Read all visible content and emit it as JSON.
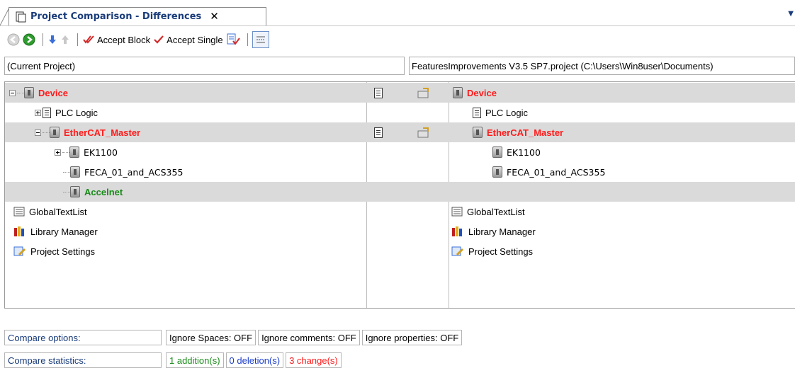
{
  "tab": {
    "title": "Project Comparison - Differences",
    "close": "✕"
  },
  "toolbar": {
    "accept_block": "Accept Block",
    "accept_single": "Accept Single"
  },
  "paths": {
    "left": "(Current Project)",
    "right": "FeaturesImprovements V3.5 SP7.project (C:\\Users\\Win8user\\Documents)"
  },
  "tree": {
    "left": {
      "device": "Device",
      "plc_logic": "PLC Logic",
      "ethercat_master": "EtherCAT_Master",
      "ek1100": "EK1100",
      "feca": "FECA_01_and_ACS355",
      "accelnet": "Accelnet",
      "global_text_list": "GlobalTextList",
      "library_manager": "Library Manager",
      "project_settings": "Project Settings"
    },
    "right": {
      "device": "Device",
      "plc_logic": "PLC Logic",
      "ethercat_master": "EtherCAT_Master",
      "ek1100": "EK1100",
      "feca": "FECA_01_and_ACS355",
      "global_text_list": "GlobalTextList",
      "library_manager": "Library Manager",
      "project_settings": "Project Settings"
    }
  },
  "footer": {
    "options_label": "Compare options:",
    "options": [
      "Ignore Spaces: OFF",
      "Ignore comments: OFF",
      "Ignore properties: OFF"
    ],
    "stats_label": "Compare statistics:",
    "stats": {
      "additions": "1 addition(s)",
      "deletions": "0 deletion(s)",
      "changes": "3 change(s)"
    }
  },
  "colors": {
    "changed": "#ff1a1a",
    "added": "#1a8a1a",
    "deleted": "#1a3cc8",
    "diff_row": "#dadada",
    "title": "#1a3c7a"
  }
}
